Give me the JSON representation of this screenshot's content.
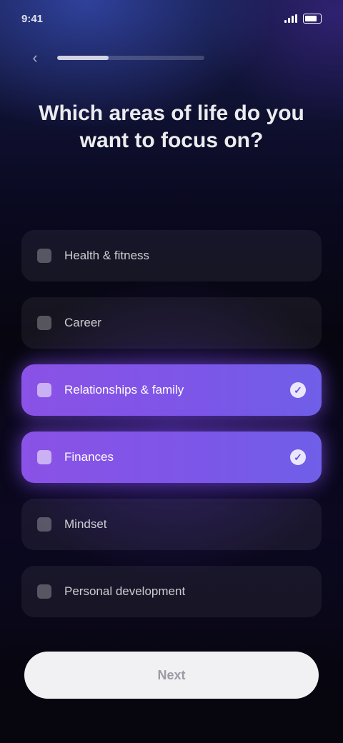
{
  "status_bar": {
    "time": "9:41"
  },
  "progress": {
    "value": 0.35
  },
  "question": {
    "text": "Which areas of life do you want to focus on?"
  },
  "options": [
    {
      "label": "Health & fitness",
      "selected": false
    },
    {
      "label": "Career",
      "selected": false
    },
    {
      "label": "Relationships & family",
      "selected": true
    },
    {
      "label": "Finances",
      "selected": true
    },
    {
      "label": "Mindset",
      "selected": false
    },
    {
      "label": "Personal development",
      "selected": false
    }
  ],
  "footer": {
    "next_label": "Next"
  },
  "icons": {
    "back": "chevron-left-icon",
    "selected": "check-icon"
  },
  "colors": {
    "accent_start": "#8a52e6",
    "accent_end": "#6f5fe8",
    "button_bg": "#f1f0f3"
  }
}
